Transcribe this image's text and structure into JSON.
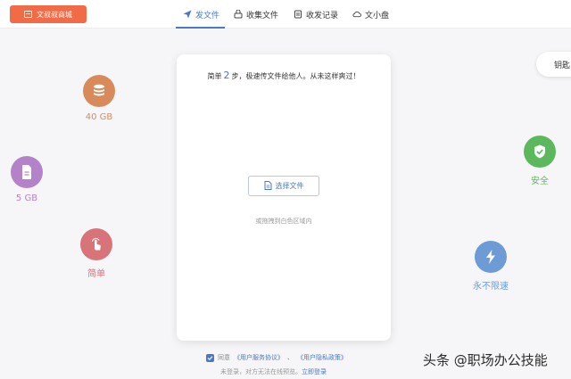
{
  "topbar": {
    "store_button": "文叔叔商城",
    "tabs": [
      {
        "label": "发文件",
        "icon": "send-icon",
        "active": true
      },
      {
        "label": "收集文件",
        "icon": "collect-icon",
        "active": false
      },
      {
        "label": "收发记录",
        "icon": "record-icon",
        "active": false
      },
      {
        "label": "文小盘",
        "icon": "cloud-disk-icon",
        "active": false
      }
    ]
  },
  "side_pill": {
    "label": "钥匙"
  },
  "features": {
    "storage_40": {
      "label": "40 GB",
      "color": "#d98a5a",
      "icon": "database-icon"
    },
    "storage_5": {
      "label": "5 GB",
      "color": "#b482c9",
      "icon": "file-icon"
    },
    "simple": {
      "label": "简单",
      "color": "#d9737a",
      "icon": "tap-icon"
    },
    "secure": {
      "label": "安全",
      "color": "#5cb85c",
      "icon": "shield-icon"
    },
    "no_speed_limit": {
      "label": "永不限速",
      "color": "#6c9bd6",
      "icon": "lightning-icon"
    }
  },
  "card": {
    "title_prefix": "简单",
    "title_number": "2",
    "title_suffix": "步，极速传文件给他人。从未这样爽过！",
    "select_button": "选择文件",
    "drag_hint": "或拖拽到白色区域内"
  },
  "agreement": {
    "prefix": "同意",
    "service_link": "《用户服务协议》",
    "separator": "、",
    "privacy_link": "《用户隐私政策》"
  },
  "login_hint": {
    "text": "未登录，对方无法在线预览。",
    "link": "立即登录"
  },
  "watermark": "头条 @职场办公技能",
  "colors": {
    "accent": "#4a78c8",
    "store": "#f26b47"
  }
}
